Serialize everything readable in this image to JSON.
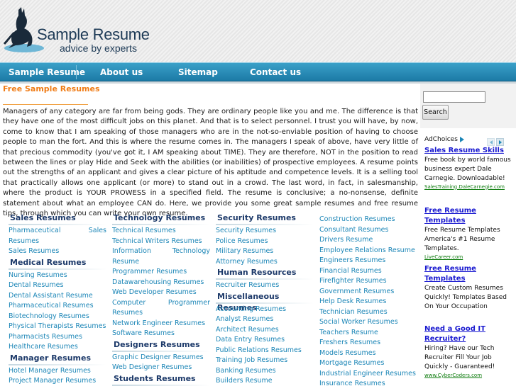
{
  "site": {
    "title": "Sample Resume",
    "tagline": "advice by experts"
  },
  "nav": [
    {
      "label": "Sample Resume"
    },
    {
      "label": "About us"
    },
    {
      "label": "Sitemap"
    },
    {
      "label": "Contact us"
    }
  ],
  "main": {
    "title": "Free Sample Resumes",
    "intro": "Managers of any category are far from being gods. They are ordinary people like you and me. The difference is that they have one of the most difficult jobs on this planet. And that is to select personnel. I trust you will have, by now, come to know that I am speaking of those managers who are in the not-so-enviable position of having to choose people to man the fort. And this is where the resume comes in. The managers I speak of above, have very little of that precious commodity (you've got it, I AM speaking about TIME). They are therefore, NOT in the position to read between the lines or play Hide and Seek with the abilities (or inabilities) of prospective employees. A resume points out the strengths of an applicant and gives a clear picture of his aptitude and competence levels. It is a selling tool that practically allows one applicant (or more) to stand out in a crowd. The last word, in fact, in salesmanship, where the product is YOUR PROWESS in a specified field. The resume is conclusive; a no-nonsense, definite statement about what an employee CAN do. Here, we provide you some great sample resumes and free resume tips, through which you can write your own resume."
  },
  "columns": {
    "col1": {
      "sales": {
        "heading": "Sales Resumes",
        "items": [
          "Pharmaceutical Sales",
          "Resumes",
          "Sales Resumes"
        ]
      },
      "medical": {
        "heading": "Medical Resumes",
        "items": [
          "Nursing Resumes",
          "Dental Resumes",
          "Dental Assistant Resume",
          "Pharmaceutical Resumes",
          "Biotechnology Resumes",
          "Physical Therapists Resumes",
          "Pharmacists Resumes",
          "Healthcare Resumes"
        ]
      },
      "manager": {
        "heading": "Manager Resumes",
        "items": [
          "Hotel Manager Resumes",
          "Project Manager Resumes"
        ]
      }
    },
    "col2": {
      "technology": {
        "heading": "Technology Resumes",
        "items": [
          "Technical Resumes",
          "Technical Writers Resumes",
          "Information Technology",
          "Resume",
          "Programmer Resumes",
          "Datawarehousing Resumes",
          "Web Developer Resumes",
          "Computer Programmer",
          "Resumes",
          "Network Engineer Resumes",
          "Software Resumes"
        ]
      },
      "designers": {
        "heading": "Designers Resumes",
        "items": [
          "Graphic Designer Resumes",
          "Web Designer Resumes"
        ]
      },
      "students": {
        "heading": "Students Resumes",
        "items": []
      }
    },
    "col3": {
      "security": {
        "heading": "Security Resumes",
        "items": [
          "Security Resumes",
          "Police Resumes",
          "Military Resumes",
          "Attorney Resumes"
        ]
      },
      "hr": {
        "heading": "Human Resources",
        "items": [
          "Recruiter Resumes"
        ]
      },
      "misc": {
        "heading": "Miscellaneous Resumes",
        "items": [
          "Accounting Resumes",
          "Analyst Resumes",
          "Architect Resumes",
          "Data Entry Resumes",
          "Public Relations Resumes",
          "Training Job Resumes",
          "Banking Resumes",
          "Builders Resume"
        ]
      }
    },
    "col4": {
      "items": [
        "Construction Resumes",
        "Consultant Resumes",
        "Drivers Resume",
        "Employee Relations Resume",
        "Engineers Resumes",
        "Financial Resumes",
        "Firefighter Resumes",
        "Government Resumes",
        "Help Desk Resumes",
        "Technician Resumes",
        "Social Worker Resumes",
        "Teachers Resume",
        "Freshers Resumes",
        "Models Resumes",
        "Mortgage Resumes",
        "Industrial Engineer Resumes",
        "Insurance Resumes"
      ]
    }
  },
  "sidebar": {
    "search_value": "",
    "search_button": "Search",
    "adchoices": "AdChoices",
    "ads": [
      {
        "title": "Sales Resume Skills",
        "text": "Free book by world famous business expert Dale Carnegie. Downloadable!",
        "url": "SalesTraining.DaleCarnegie.com"
      },
      {
        "title": "Free Resume Templates",
        "text": "Free Resume Templates America's #1 Resume Templates.",
        "url": "LiveCareer.com"
      },
      {
        "title": "Free Resume Templates",
        "text": "Create Custom Resumes Quickly! Templates Based On Your Occupation",
        "url": ""
      },
      {
        "title": "Need a Good IT Recruiter?",
        "text": "Hiring? Have our Tech Recruiter Fill Your Job Quickly - Guaranteed!",
        "url": "www.CyberCoders.com"
      }
    ]
  },
  "colors": {
    "accent_orange": "#f07c16",
    "nav_blue": "#2a8cb8",
    "link_blue": "#1c86b7",
    "heading_navy": "#1d3a6a",
    "ad_title": "#1a1ad0",
    "ad_url_green": "#0b7a0b"
  }
}
